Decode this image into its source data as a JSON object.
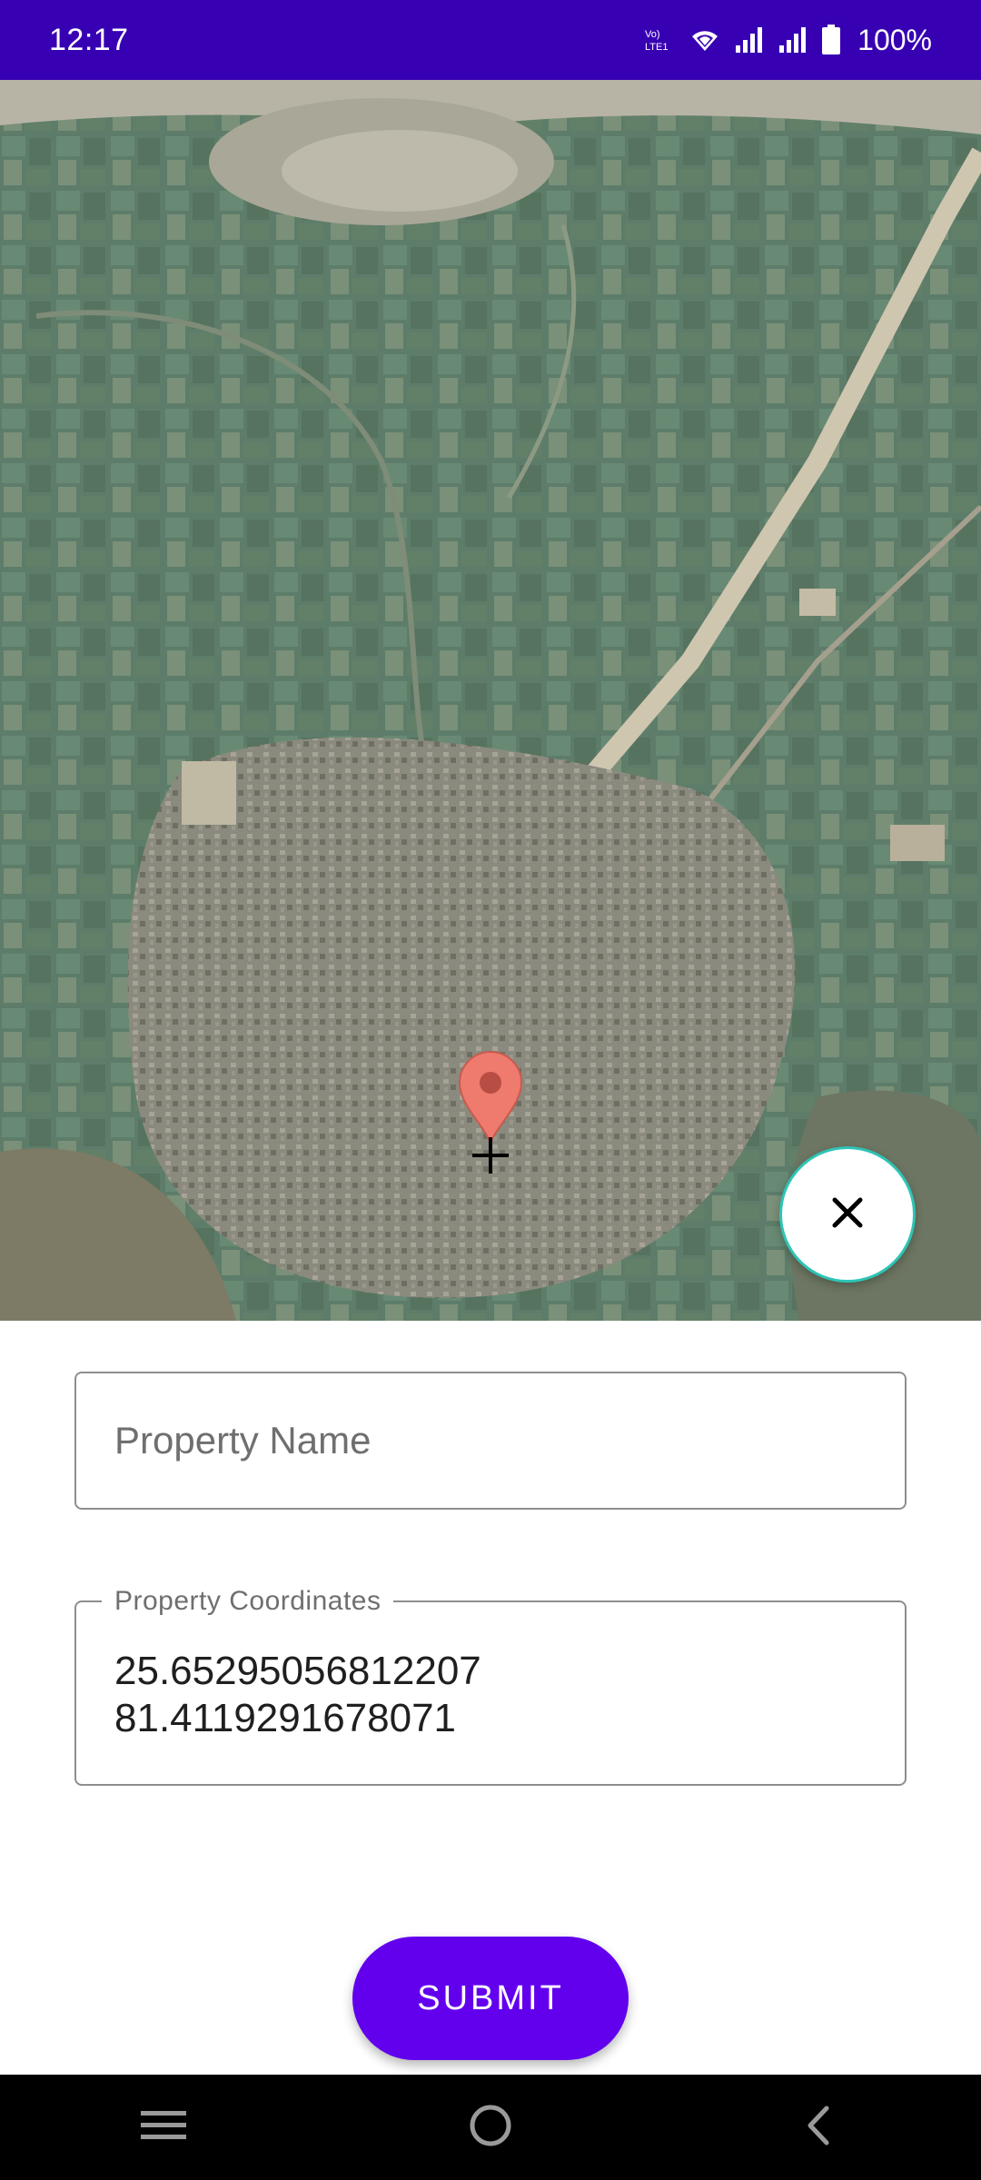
{
  "status_bar": {
    "time": "12:17",
    "network_label": "Vo) LTE1",
    "battery": "100%",
    "icons": [
      "volte-icon",
      "wifi-icon",
      "signal-icon",
      "signal-icon",
      "battery-icon"
    ]
  },
  "map": {
    "marker_icon": "location-pin-icon",
    "marker_color": "#EE7B6E",
    "center_icon": "crosshair-icon",
    "close_icon": "close-icon",
    "close_border_color": "#2EC4B6"
  },
  "form": {
    "name_placeholder": "Property Name",
    "coords_label": "Property Coordinates",
    "coords_value": "25.65295056812207\n81.4119291678071"
  },
  "actions": {
    "submit_label": "SUBMIT",
    "submit_color": "#6200EE"
  },
  "nav": {
    "icons": [
      "menu-icon",
      "home-icon",
      "back-icon"
    ]
  },
  "colors": {
    "status_bar": "#3700B3",
    "accent": "#6200EE"
  }
}
